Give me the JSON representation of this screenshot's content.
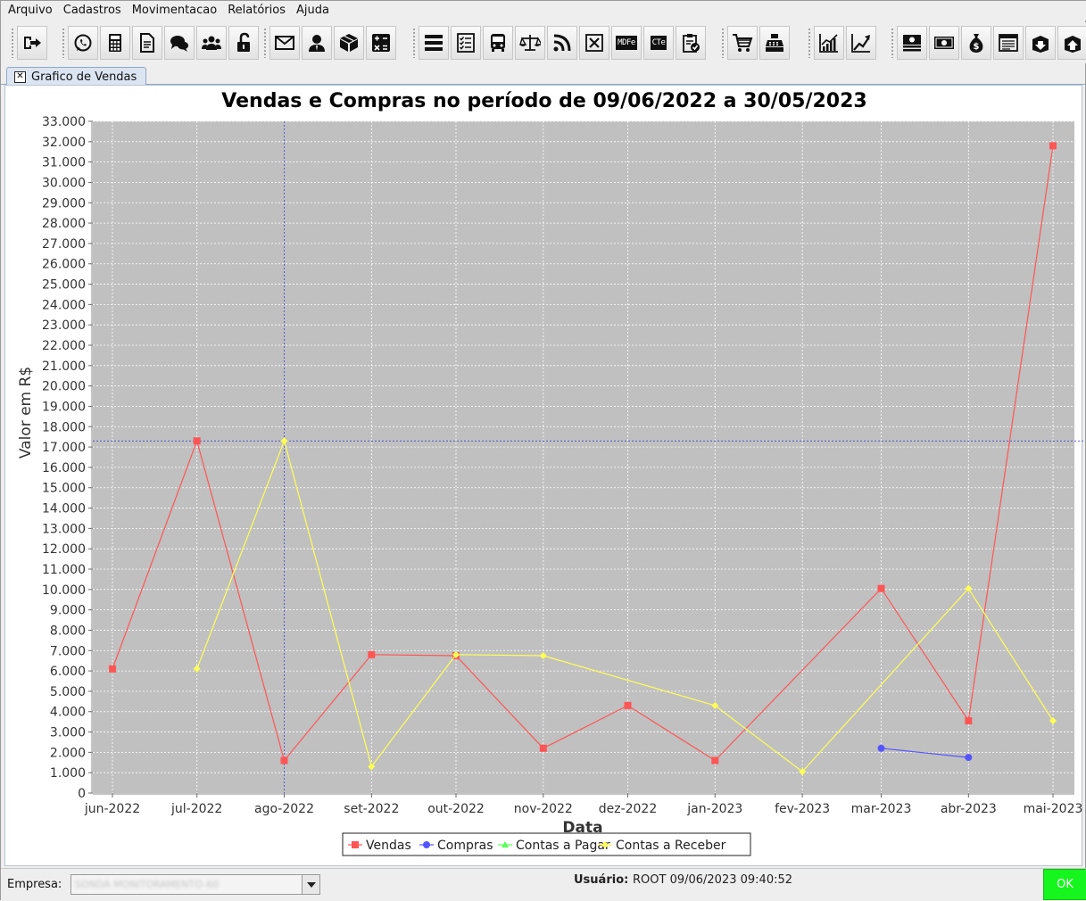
{
  "menu": [
    "Arquivo",
    "Cadastros",
    "Movimentacao",
    "Relatórios",
    "Ajuda"
  ],
  "toolbar": {
    "groups": [
      [
        "exit-icon"
      ],
      [
        "whatsapp-icon",
        "calculator-icon",
        "document-icon",
        "chat-icon",
        "users-icon",
        "unlock-icon"
      ],
      [
        "mail-icon",
        "client-icon",
        "box-icon",
        "math-icon"
      ],
      [
        "list-icon",
        "checklist-icon",
        "bus-icon",
        "scale-icon",
        "rss-icon",
        "cancel-icon",
        "mdfe-icon",
        "cte-icon",
        "clipboard-check-icon"
      ],
      [
        "cart-icon",
        "cash-register-icon"
      ],
      [
        "chart-up-icon",
        "trend-icon"
      ],
      [
        "money-stack-icon",
        "banknote-icon",
        "money-bag-icon",
        "ledger-icon",
        "box-down-icon",
        "box-up-icon"
      ]
    ],
    "mdfe_text": "MDFe",
    "cte_text": "CTe"
  },
  "tab": {
    "label": "Grafico de Vendas"
  },
  "chart_data": {
    "type": "line",
    "title": "Vendas e Compras no período de 09/06/2022 a 30/05/2023",
    "xlabel": "Data",
    "ylabel": "Valor em R$",
    "categories": [
      "jun-2022",
      "jul-2022",
      "ago-2022",
      "set-2022",
      "out-2022",
      "nov-2022",
      "dez-2022",
      "jan-2023",
      "fev-2023",
      "mar-2023",
      "abr-2023",
      "mai-2023"
    ],
    "category_dates": [
      "2022-06-01",
      "2022-07-01",
      "2022-08-01",
      "2022-09-01",
      "2022-10-01",
      "2022-11-01",
      "2022-12-01",
      "2023-01-01",
      "2023-02-01",
      "2023-03-01",
      "2023-04-01",
      "2023-05-01"
    ],
    "yticks": [
      "0",
      "1.000",
      "2.000",
      "3.000",
      "4.000",
      "5.000",
      "6.000",
      "7.000",
      "8.000",
      "9.000",
      "10.000",
      "11.000",
      "12.000",
      "13.000",
      "14.000",
      "15.000",
      "16.000",
      "17.000",
      "18.000",
      "19.000",
      "20.000",
      "21.000",
      "22.000",
      "23.000",
      "24.000",
      "25.000",
      "26.000",
      "27.000",
      "28.000",
      "29.000",
      "30.000",
      "31.000",
      "32.000",
      "33.000"
    ],
    "ylim": [
      0,
      33000
    ],
    "grid": true,
    "crosshair": {
      "x_date": "2022-08-01",
      "y": 17300
    },
    "legend_position": "bottom-center",
    "series": [
      {
        "name": "Vendas",
        "color": "#ff5555",
        "marker": "square",
        "points": [
          [
            "2022-06-01",
            6100
          ],
          [
            "2022-07-01",
            17300
          ],
          [
            "2022-08-01",
            1600
          ],
          [
            "2022-09-01",
            6800
          ],
          [
            "2022-10-01",
            6750
          ],
          [
            "2022-11-01",
            2200
          ],
          [
            "2022-12-01",
            4300
          ],
          [
            "2023-01-01",
            1600
          ],
          [
            "2023-03-01",
            10050
          ],
          [
            "2023-04-01",
            3550
          ],
          [
            "2023-05-01",
            31800
          ]
        ]
      },
      {
        "name": "Compras",
        "color": "#5555ff",
        "marker": "circle",
        "points": [
          [
            "2023-03-01",
            2200
          ],
          [
            "2023-04-01",
            1750
          ]
        ]
      },
      {
        "name": "Contas a Pagar",
        "color": "#55ff55",
        "marker": "triangle",
        "points": []
      },
      {
        "name": "Contas a Receber",
        "color": "#ffff55",
        "marker": "diamond",
        "points": [
          [
            "2022-07-01",
            6100
          ],
          [
            "2022-08-01",
            17300
          ],
          [
            "2022-09-01",
            1300
          ],
          [
            "2022-10-01",
            6800
          ],
          [
            "2022-11-01",
            6750
          ],
          [
            "2023-01-01",
            4300
          ],
          [
            "2023-02-01",
            1050
          ],
          [
            "2023-04-01",
            10050
          ],
          [
            "2023-05-01",
            3550
          ]
        ]
      }
    ]
  },
  "status": {
    "empresa_label": "Empresa:",
    "empresa_value": "SONDA MONITORAMENTO-60",
    "usuario_label": "Usuário:",
    "usuario_value": "ROOT 09/06/2023 09:40:52",
    "ok_label": "OK"
  },
  "colors": {
    "plot_bg": "#c0c0c0",
    "ok_button": "#16f51d",
    "tab_bg": "#dbe5f2"
  }
}
